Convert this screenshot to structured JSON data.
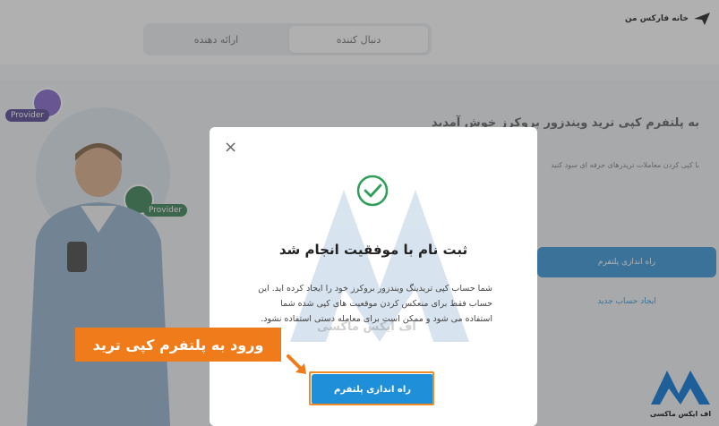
{
  "tabs": {
    "follower": "دنبال کننده",
    "provider": "ارائه دهنده"
  },
  "hero": {
    "title": "به پلتفرم کپی ترید ویندزور بروکرز خوش آمدید",
    "subtitle": "با کپی کردن معاملات تریدرهای حرفه ای سود کنید",
    "cta": "راه اندازی پلتفرم",
    "link": "ایجاد حساب جدید"
  },
  "badges": {
    "provider1": "Provider",
    "provider2": "Provider"
  },
  "brand_top": "خانه فارکس من",
  "modal": {
    "close": "×",
    "title": "ثبت نام با موفقیت انجام شد",
    "body": "شما حساب کپی تریدینگ ویندزور بروکرز خود را ایجاد کرده اید. این حساب فقط برای منعکس کردن موقعیت های کپی شده شما استفاده می شود و ممکن است برای معامله دستی استفاده نشود.",
    "button": "راه اندازی پلتفرم"
  },
  "annotation": "ورود به پلتفرم کپی ترید",
  "watermark": "اف ایکس ماکسی",
  "brand_bottom": "اف ایکس ماکسی",
  "colors": {
    "accent": "#1f8fd9",
    "annotation": "#f07b1a",
    "success": "#2e9e58"
  }
}
